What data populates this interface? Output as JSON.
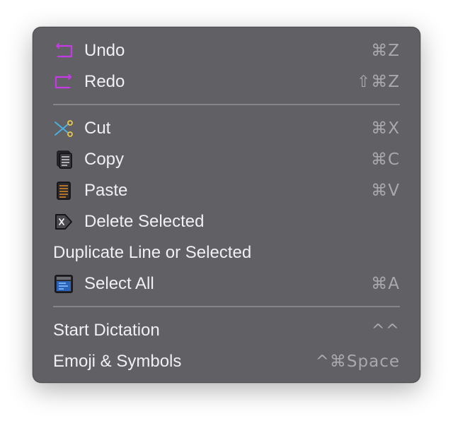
{
  "menu": {
    "items": [
      {
        "label": "Undo",
        "shortcut": "⌘Z",
        "icon": "undo-icon"
      },
      {
        "label": "Redo",
        "shortcut": "⇧⌘Z",
        "icon": "redo-icon"
      },
      {
        "label": "Cut",
        "shortcut": "⌘X",
        "icon": "cut-icon"
      },
      {
        "label": "Copy",
        "shortcut": "⌘C",
        "icon": "copy-icon"
      },
      {
        "label": "Paste",
        "shortcut": "⌘V",
        "icon": "paste-icon"
      },
      {
        "label": "Delete Selected",
        "shortcut": "",
        "icon": "delete-icon"
      },
      {
        "label": "Duplicate Line or Selected",
        "shortcut": "",
        "icon": ""
      },
      {
        "label": "Select All",
        "shortcut": "⌘A",
        "icon": "select-all-icon"
      },
      {
        "label": "Start Dictation",
        "shortcut": "^^",
        "icon": ""
      },
      {
        "label": "Emoji & Symbols",
        "shortcut": "^⌘Space",
        "icon": ""
      }
    ]
  },
  "colors": {
    "menu_background": "#616064",
    "text": "#f0eff2",
    "shortcut_text": "#a9a8ad",
    "separator": "#858489",
    "undo_redo_accent": "#c639e6",
    "cut_accent": "#49b3e3",
    "cut_handle": "#e8c84a",
    "paste_accent": "#e08a2a",
    "select_all_accent": "#3b8fe8"
  }
}
